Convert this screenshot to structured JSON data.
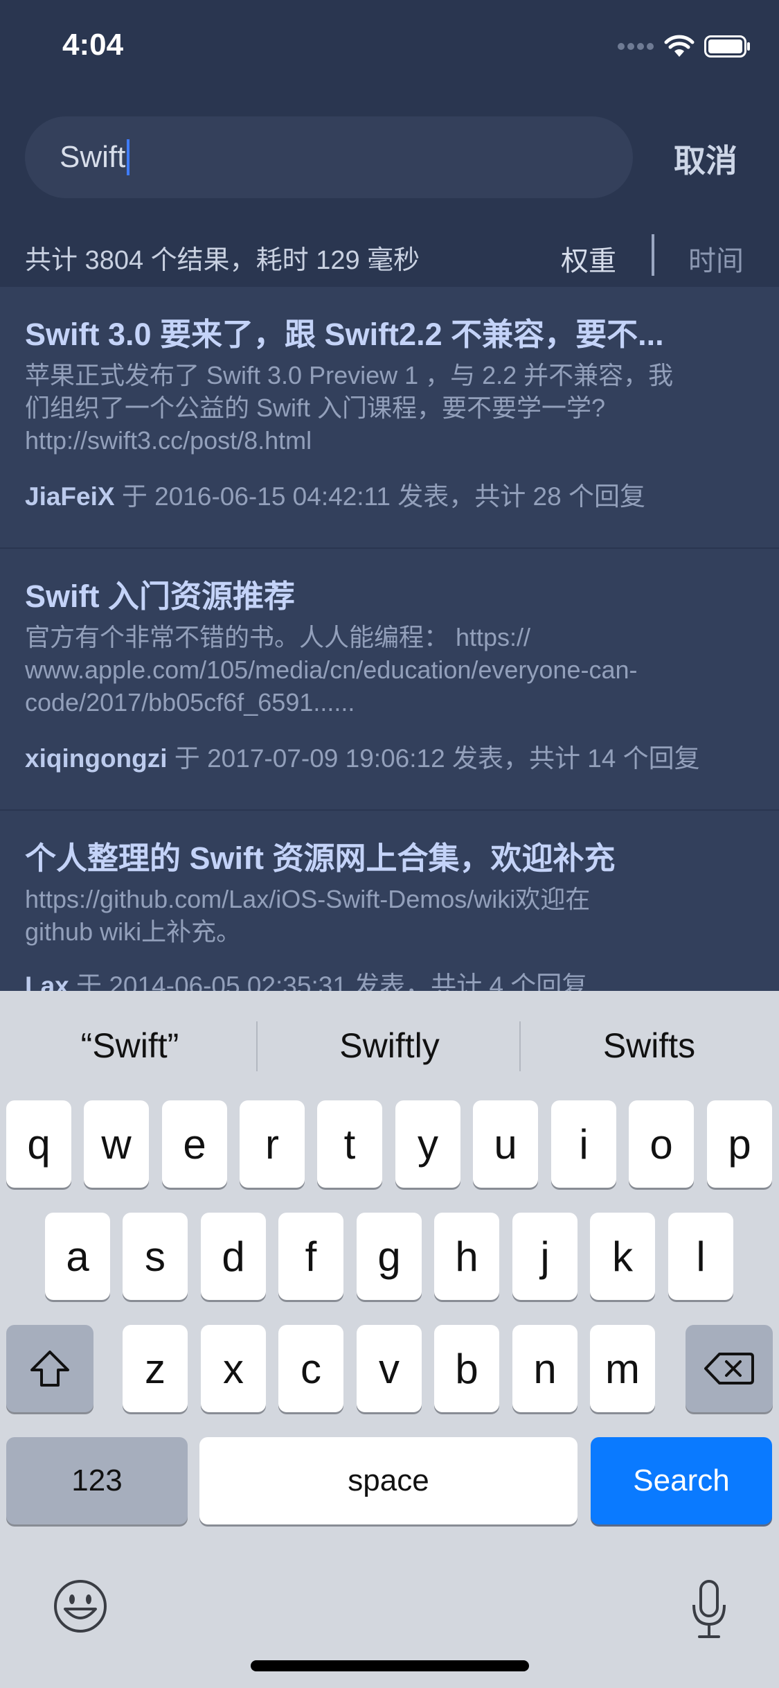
{
  "status_bar": {
    "time": "4:04",
    "icons": [
      "signal-dots-icon",
      "wifi-icon",
      "battery-icon"
    ]
  },
  "search": {
    "value": "Swift",
    "cancel_label": "取消"
  },
  "summary": {
    "text": "共计 3804 个结果，耗时 129 毫秒",
    "sort_weight": "权重",
    "sort_time": "时间"
  },
  "results": [
    {
      "title": "Swift 3.0 要来了，跟 Swift2.2 不兼容，要不...",
      "excerpt": "苹果正式发布了 Swift 3.0 Preview 1 ，与 2.2 并不兼容，我\n们组织了一个公益的 Swift 入门课程，要不要学一学?\nhttp://swift3.cc/post/8.html",
      "author": "JiaFeiX",
      "meta": " 于 2016-06-15 04:42:11 发表，共计 28 个回复"
    },
    {
      "title": "Swift 入门资源推荐",
      "excerpt": "官方有个非常不错的书。人人能编程： https://\nwww.apple.com/105/media/cn/education/everyone-can-\ncode/2017/bb05cf6f_6591......",
      "author": "xiqingongzi",
      "meta": " 于 2017-07-09 19:06:12 发表，共计 14 个回复"
    },
    {
      "title": "个人整理的 Swift 资源网上合集，欢迎补充",
      "excerpt": "https://github.com/Lax/iOS-Swift-Demos/wiki欢迎在\ngithub wiki上补充。",
      "author": "Lax",
      "meta": " 于 2014-06-05 02:35:31 发表，共计 4 个回复"
    }
  ],
  "keyboard": {
    "suggestions": [
      "“Swift”",
      "Swiftly",
      "Swifts"
    ],
    "row1": [
      "q",
      "w",
      "e",
      "r",
      "t",
      "y",
      "u",
      "i",
      "o",
      "p"
    ],
    "row2": [
      "a",
      "s",
      "d",
      "f",
      "g",
      "h",
      "j",
      "k",
      "l"
    ],
    "row3": [
      "z",
      "x",
      "c",
      "v",
      "b",
      "n",
      "m"
    ],
    "numbers_label": "123",
    "space_label": "space",
    "search_label": "Search",
    "icons": [
      "shift-icon",
      "delete-icon",
      "emoji-icon",
      "microphone-icon"
    ]
  },
  "colors": {
    "background": "#2a3650",
    "list_background": "#33405c",
    "accent": "#0a7aff",
    "keyboard_background": "#d3d7de"
  }
}
